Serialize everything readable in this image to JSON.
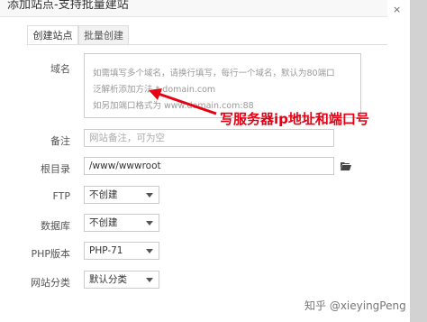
{
  "dialog": {
    "title": "添加站点-支持批量建站",
    "close_glyph": "×"
  },
  "tabs": [
    {
      "label": "创建站点",
      "active": true
    },
    {
      "label": "批量创建",
      "active": false
    }
  ],
  "form": {
    "domain": {
      "label": "域名",
      "placeholder_lines": [
        "如需填写多个域名，请换行填写，每行一个域名，默认为80端口",
        "泛解析添加方法 *.domain.com",
        "如另加端口格式为 www.domain.com:88"
      ]
    },
    "remark": {
      "label": "备注",
      "placeholder": "网站备注，可为空"
    },
    "root": {
      "label": "根目录",
      "value": "/www/wwwroot"
    },
    "ftp": {
      "label": "FTP",
      "selected": "不创建"
    },
    "database": {
      "label": "数据库",
      "selected": "不创建"
    },
    "php": {
      "label": "PHP版本",
      "selected": "PHP-71"
    },
    "category": {
      "label": "网站分类",
      "selected": "默认分类"
    }
  },
  "annotation": {
    "text": "写服务器ip地址和端口号",
    "color": "#e60012"
  },
  "watermark": {
    "text": "知乎 @xieyingPeng"
  },
  "icons": {
    "folder": "folder-open-icon",
    "close": "close-icon"
  }
}
